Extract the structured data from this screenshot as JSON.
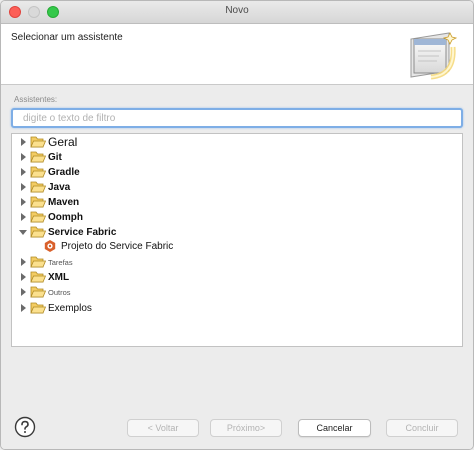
{
  "window": {
    "title": "Novo"
  },
  "header": {
    "title": "Selecionar um assistente",
    "banner_icon": "new-wizard-banner-icon"
  },
  "wizards": {
    "section_label": "Assistentes:",
    "filter_placeholder": "digite o texto de filtro",
    "tree": [
      {
        "label": "Geral",
        "expanded": false,
        "icon": "folder-icon"
      },
      {
        "label": "Git",
        "expanded": false,
        "icon": "folder-icon"
      },
      {
        "label": "Gradle",
        "expanded": false,
        "icon": "folder-icon"
      },
      {
        "label": "Java",
        "expanded": false,
        "icon": "folder-icon"
      },
      {
        "label": "Maven",
        "expanded": false,
        "icon": "folder-icon"
      },
      {
        "label": "Oomph",
        "expanded": false,
        "icon": "folder-icon"
      },
      {
        "label": "Service Fabric",
        "expanded": true,
        "icon": "folder-open-icon",
        "children": [
          {
            "label": "Projeto do Service Fabric",
            "icon": "service-fabric-icon"
          }
        ]
      },
      {
        "label": "Tarefas",
        "expanded": false,
        "icon": "folder-icon"
      },
      {
        "label": "XML",
        "expanded": false,
        "icon": "folder-icon"
      },
      {
        "label": "Outros",
        "expanded": false,
        "icon": "folder-icon"
      },
      {
        "label": "Exemplos",
        "expanded": false,
        "icon": "folder-icon"
      }
    ]
  },
  "footer": {
    "help_icon": "help-icon",
    "back_label": "< Voltar",
    "next_label": "Próximo>",
    "cancel_label": "Cancelar",
    "finish_label": "Concluir"
  },
  "colors": {
    "focus_ring": "#7eaee6",
    "folder": "#f0c050",
    "service_fabric": "#d9602b"
  }
}
